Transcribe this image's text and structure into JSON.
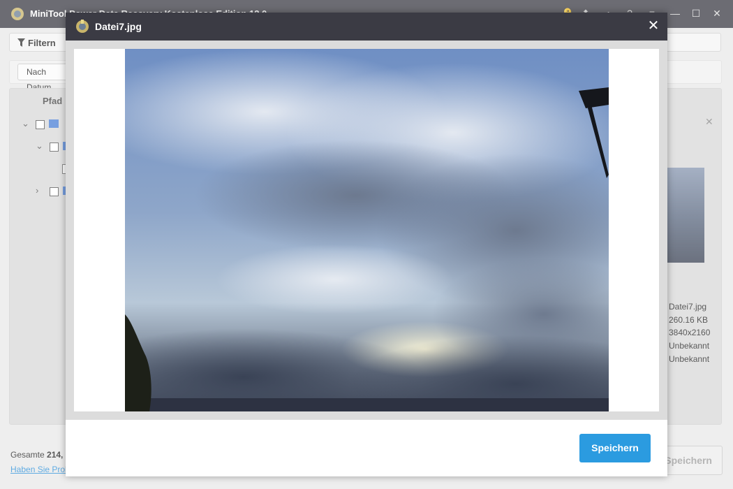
{
  "app": {
    "title": "MiniTool Power Data Recovery Kostenlose Edition 12.0",
    "toolbar": {
      "filter_label": "Filtern"
    },
    "subbar": {
      "date_button": "Nach Datum"
    },
    "panel": {
      "path_header": "Pfad"
    },
    "file_info": {
      "name": "Datei7.jpg",
      "size": "260.16 KB",
      "dimensions": "3840x2160",
      "created": "Unbekannt",
      "modified": "Unbekannt"
    },
    "status": {
      "total_prefix": "Gesamte",
      "total_value": "214,",
      "help_link": "Haben Sie Probleme?",
      "save_button": "Speichern"
    }
  },
  "modal": {
    "title": "Datei7.jpg",
    "close_symbol": "✕",
    "save_button": "Speichern"
  },
  "colors": {
    "titlebar": "#3b3b44",
    "accent": "#2b9be0"
  }
}
